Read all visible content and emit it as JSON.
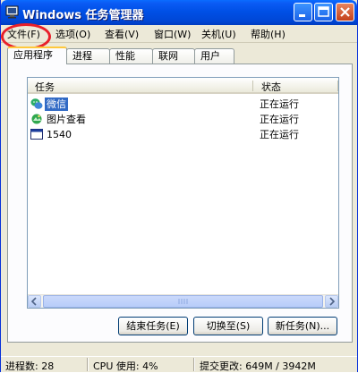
{
  "window": {
    "title": "Windows 任务管理器",
    "controls": [
      "minimize",
      "maximize",
      "close"
    ]
  },
  "menu": {
    "items": [
      {
        "label": "文件(F)"
      },
      {
        "label": "选项(O)"
      },
      {
        "label": "查看(V)"
      },
      {
        "label": "窗口(W)"
      },
      {
        "label": "关机(U)"
      },
      {
        "label": "帮助(H)"
      }
    ]
  },
  "tabs": [
    {
      "label": "应用程序",
      "active": true
    },
    {
      "label": "进程"
    },
    {
      "label": "性能"
    },
    {
      "label": "联网"
    },
    {
      "label": "用户"
    }
  ],
  "table": {
    "columns": [
      "任务",
      "状态"
    ],
    "rows": [
      {
        "name": "微信",
        "status": "正在运行",
        "icon": "wechat-icon",
        "selected": true
      },
      {
        "name": "图片查看",
        "status": "正在运行",
        "icon": "image-viewer-icon"
      },
      {
        "name": "1540",
        "status": "正在运行",
        "icon": "window-icon"
      }
    ]
  },
  "buttons": {
    "end_task": "结束任务(E)",
    "switch_to": "切换至(S)",
    "new_task": "新任务(N)..."
  },
  "status": {
    "processes": "进程数: 28",
    "cpu": "CPU 使用: 4%",
    "commit": "提交更改: 649M / 3942M"
  },
  "colors": {
    "titlebar": "#0050e6",
    "selection": "#316ac5",
    "annotation": "#e8202a",
    "active_tab_accent": "#ffc83c"
  }
}
